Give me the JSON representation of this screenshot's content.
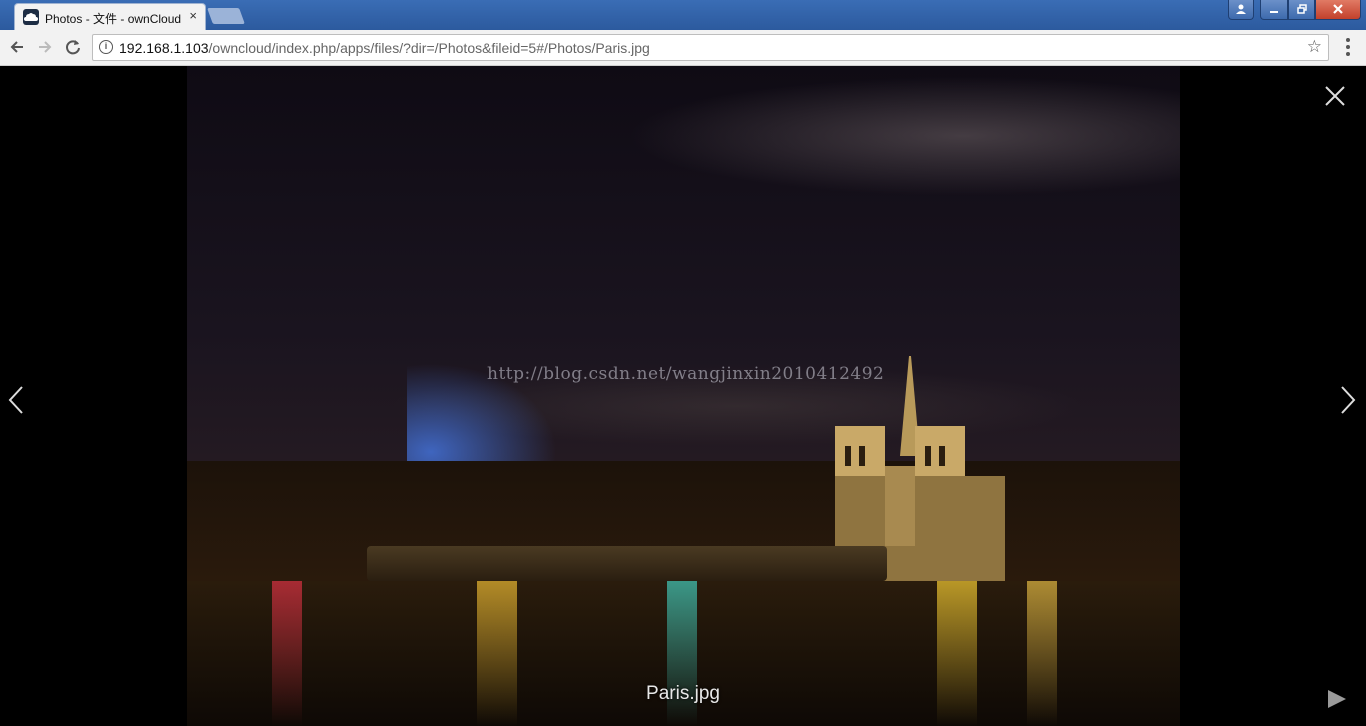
{
  "browser": {
    "tab_title": "Photos - 文件 - ownCloud",
    "tab_close": "×",
    "url_host": "192.168.1.103",
    "url_path": "/owncloud/index.php/apps/files/?dir=/Photos&fileid=5#/Photos/Paris.jpg",
    "info_symbol": "i",
    "star_symbol": "☆"
  },
  "viewer": {
    "file_name": "Paris.jpg",
    "watermark": "http://blog.csdn.net/wangjinxin2010412492"
  },
  "colors": {
    "titlebar": "#2c5a9e",
    "toolbar": "#f2f2f2",
    "viewer_bg": "#000000"
  },
  "icons": [
    "owncloud-favicon",
    "back-arrow-icon",
    "forward-arrow-icon",
    "reload-icon",
    "info-icon",
    "star-icon",
    "menu-icon",
    "close-icon",
    "chevron-left-icon",
    "chevron-right-icon",
    "play-icon"
  ]
}
